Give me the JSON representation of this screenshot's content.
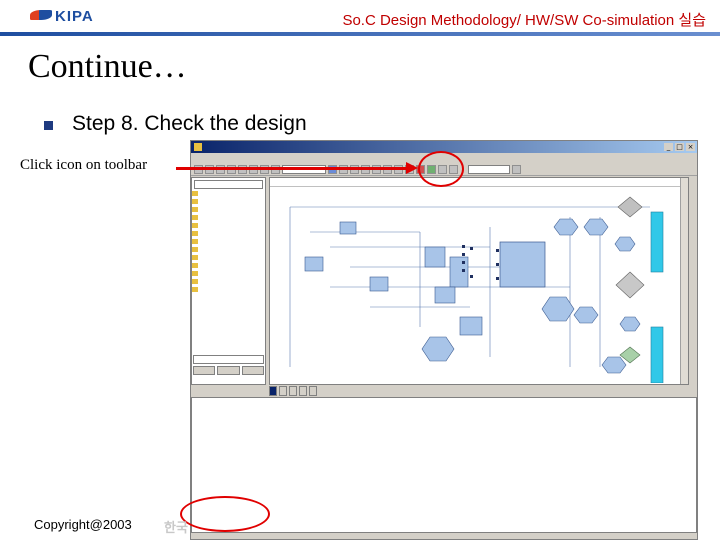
{
  "header": {
    "logo_text": "KIPA",
    "title": "So.C Design Methodology/ HW/SW Co-simulation 실습"
  },
  "slide": {
    "title": "Continue…",
    "step": "Step 8. Check the design",
    "annotation": "Click icon on toolbar"
  },
  "footer": {
    "copyright": "Copyright@2003",
    "korean": "한국"
  },
  "colors": {
    "header_title": "#c00000",
    "arrow": "#e00000",
    "accent": "#1e4ea0",
    "cyan_block": "#30c8e8"
  }
}
